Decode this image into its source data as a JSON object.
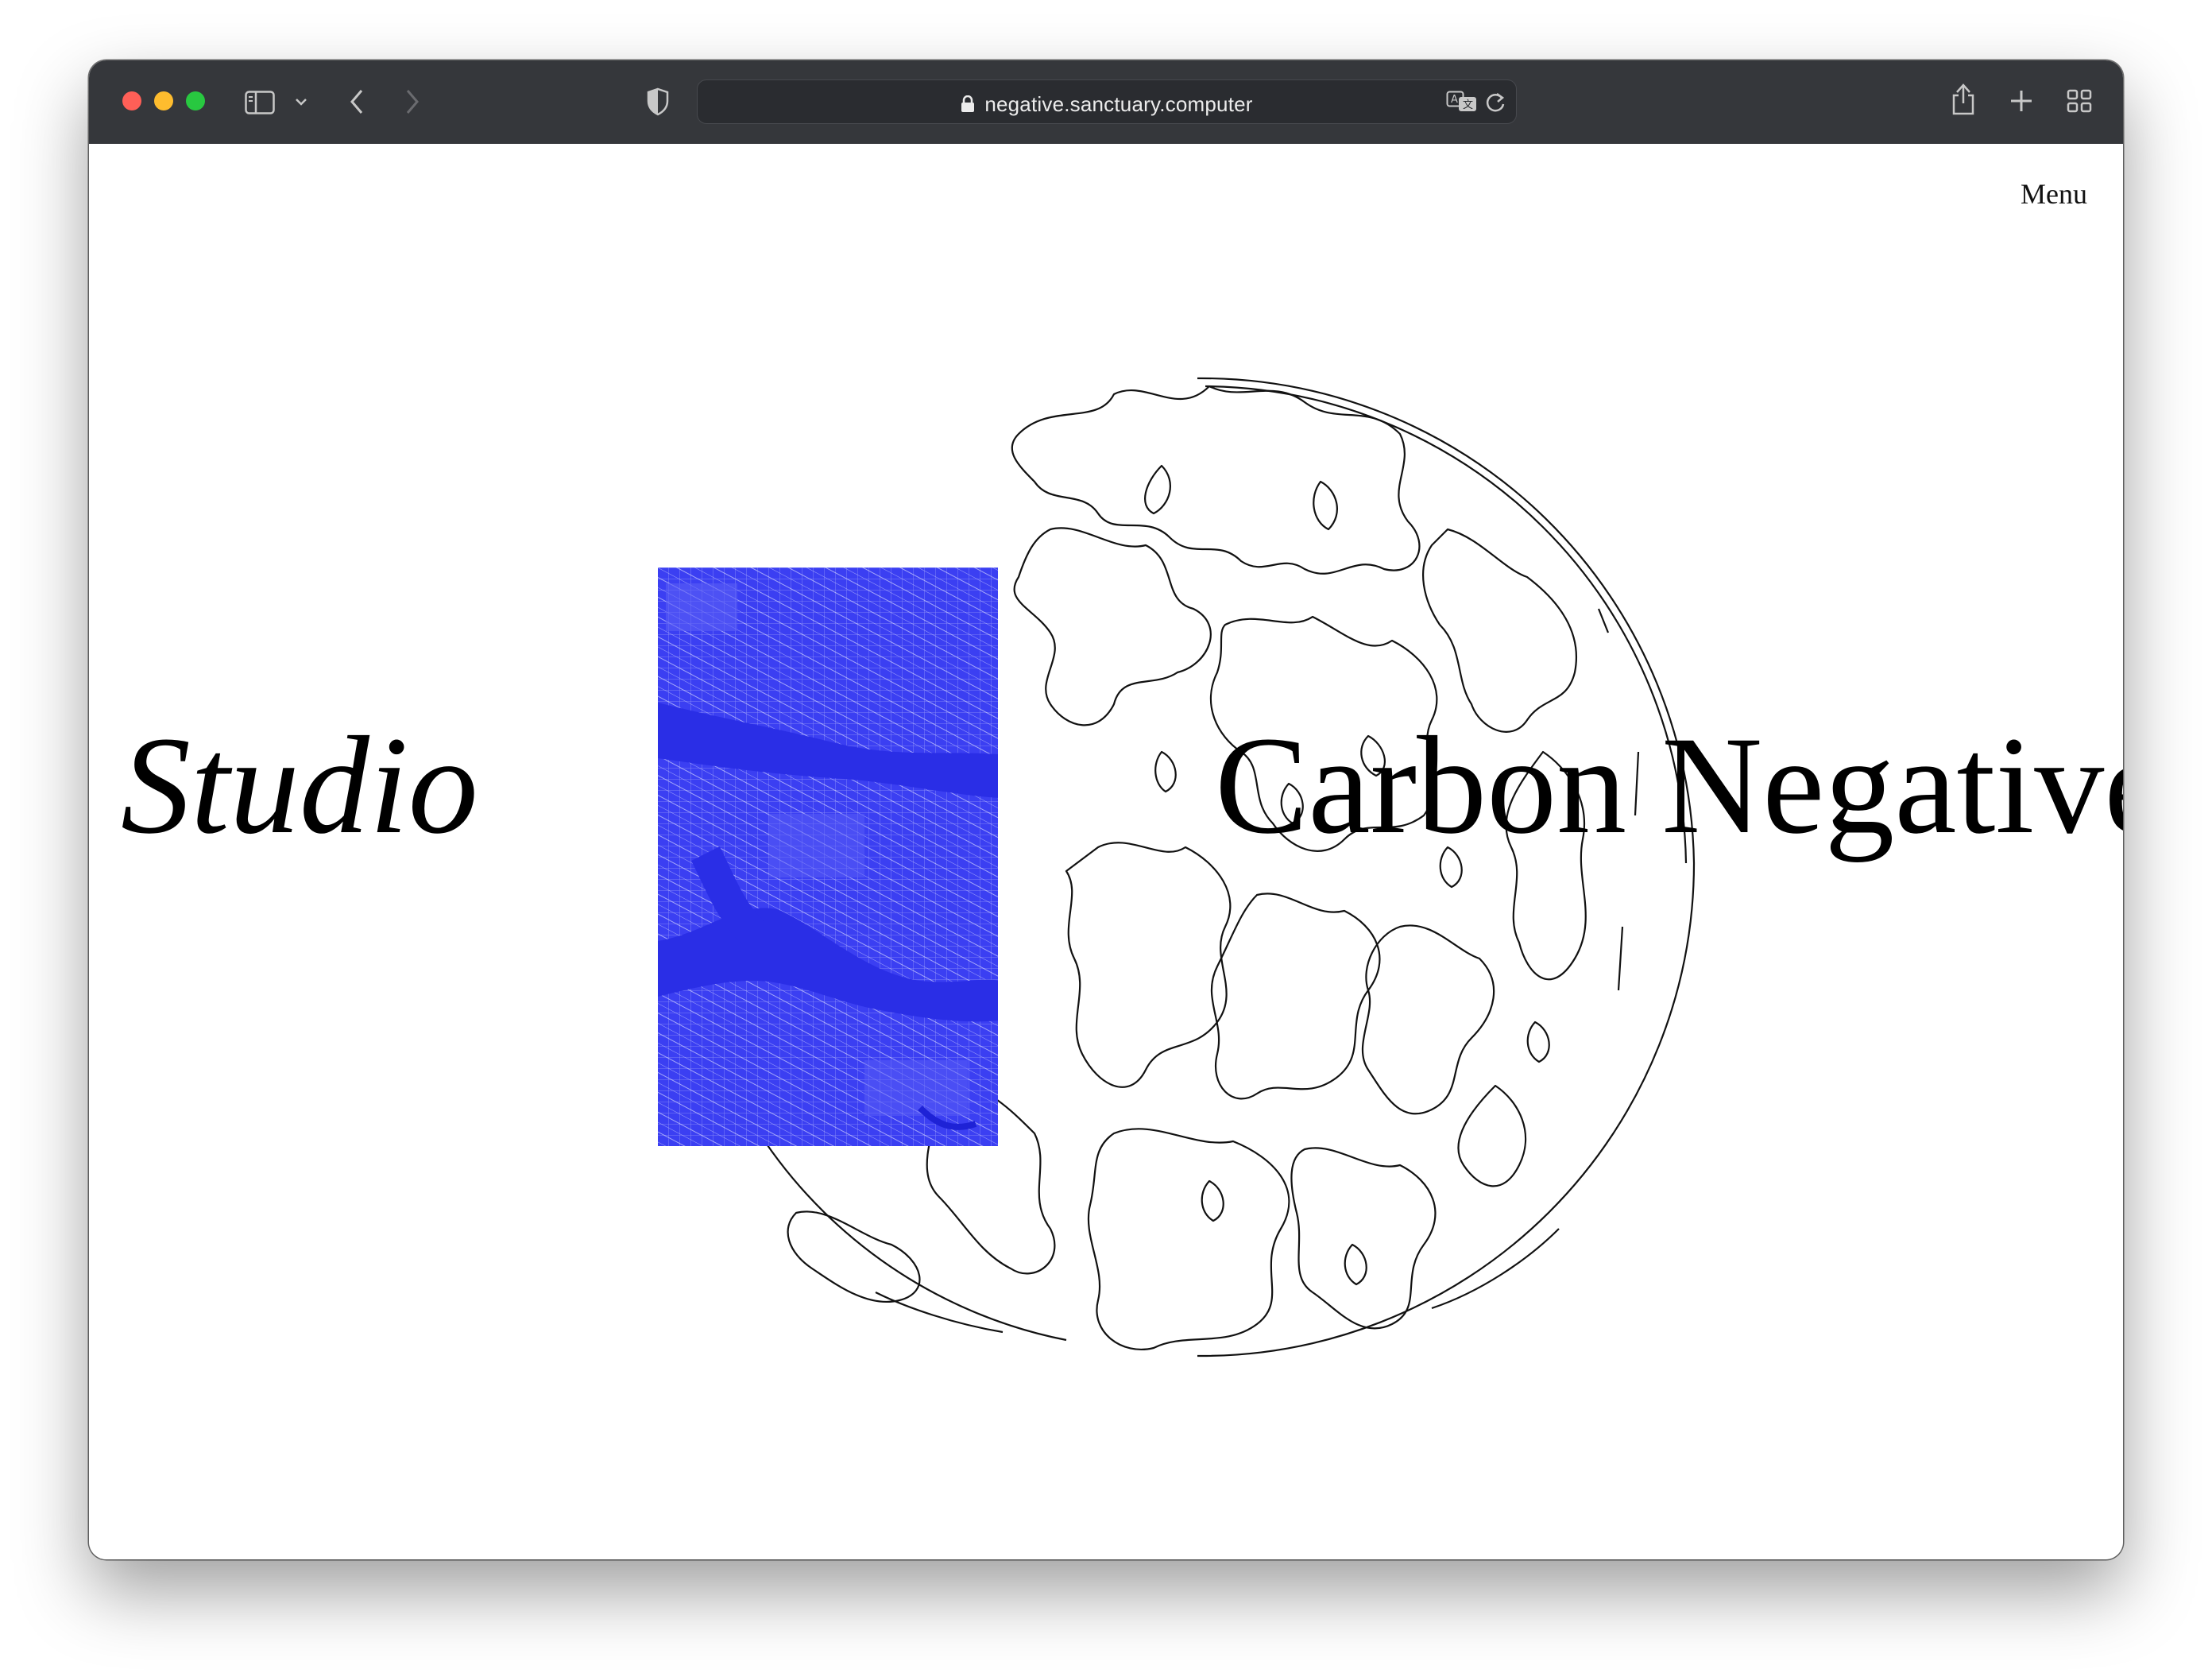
{
  "browser": {
    "url": "negative.sanctuary.computer",
    "icons": {
      "sidebar": "sidebar-icon",
      "chevron": "chevron-down-icon",
      "back": "back-arrow-icon",
      "forward": "forward-arrow-icon",
      "privacy": "shield-icon",
      "lock": "lock-icon",
      "translate": "translate-icon",
      "reload": "reload-icon",
      "share": "share-icon",
      "new_tab": "plus-icon",
      "tabs": "tab-overview-icon"
    },
    "traffic_light_colors": [
      "#ff5f57",
      "#febc2e",
      "#28c840"
    ]
  },
  "page": {
    "menu_label": "Menu",
    "headline_left": "Studio",
    "headline_right": "Carbon Negative",
    "accent_color": "#3b3ff2"
  }
}
